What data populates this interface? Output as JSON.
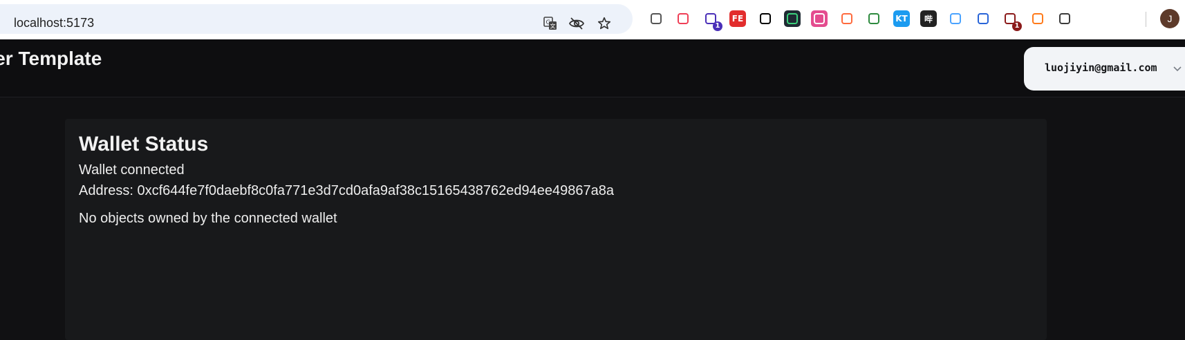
{
  "browser": {
    "url": "localhost:5173",
    "omnibox_icons": [
      "translate-icon",
      "eye-off-icon",
      "star-icon"
    ],
    "extensions": [
      {
        "icon": "bitwarden-icon",
        "glyph": "",
        "bg": "#ffffff",
        "fg": "#555555",
        "badge": ""
      },
      {
        "icon": "pocket-icon",
        "glyph": "",
        "bg": "#ffffff",
        "fg": "#ef3f56",
        "badge": ""
      },
      {
        "icon": "graduation-cap-icon",
        "glyph": "",
        "bg": "#ffffff",
        "fg": "#4a2fb8",
        "badge": "1"
      },
      {
        "icon": "fe-helper-icon",
        "glyph": "FE",
        "bg": "#e22d2d",
        "fg": "#ffffff",
        "badge": ""
      },
      {
        "icon": "glasses-icon",
        "glyph": "",
        "bg": "#ffffff",
        "fg": "#000000",
        "badge": ""
      },
      {
        "icon": "terminal-icon",
        "glyph": "",
        "bg": "#1f2a33",
        "fg": "#3bd17c",
        "badge": ""
      },
      {
        "icon": "translate-ext-icon",
        "glyph": "",
        "bg": "#e44c8f",
        "fg": "#ffffff",
        "badge": ""
      },
      {
        "icon": "bubbles-icon",
        "glyph": "",
        "bg": "#ffffff",
        "fg": "#ff6a3d",
        "badge": ""
      },
      {
        "icon": "globe-download-icon",
        "glyph": "",
        "bg": "#ffffff",
        "fg": "#2d8a3e",
        "badge": ""
      },
      {
        "icon": "kt-icon",
        "glyph": "KT",
        "bg": "#1b9bf0",
        "fg": "#ffffff",
        "badge": ""
      },
      {
        "icon": "bilibili-icon",
        "glyph": "哔",
        "bg": "#222222",
        "fg": "#ffffff",
        "badge": ""
      },
      {
        "icon": "droplet-icon",
        "glyph": "",
        "bg": "#ffffff",
        "fg": "#4aa3ff",
        "badge": ""
      },
      {
        "icon": "scissors-icon",
        "glyph": "",
        "bg": "#ffffff",
        "fg": "#2864d8",
        "badge": ""
      },
      {
        "icon": "shield-icon",
        "glyph": "",
        "bg": "#ffffff",
        "fg": "#8b1a1a",
        "badge": "1"
      },
      {
        "icon": "lightning-icon",
        "glyph": "",
        "bg": "#ffffff",
        "fg": "#ff7a1a",
        "badge": ""
      },
      {
        "icon": "puzzle-icon",
        "glyph": "",
        "bg": "#ffffff",
        "fg": "#3c3c3c",
        "badge": ""
      }
    ],
    "profile_initial": "J"
  },
  "header": {
    "title": "rter Template",
    "account_label": "luojiyin@gmail.com"
  },
  "wallet": {
    "title": "Wallet Status",
    "status": "Wallet connected",
    "address_line": "Address: 0xcf644fe7f0daebf8c0fa771e3d7cd0afa9af38c15165438762ed94ee49867a8a",
    "objects_message": "No objects owned by the connected wallet"
  }
}
